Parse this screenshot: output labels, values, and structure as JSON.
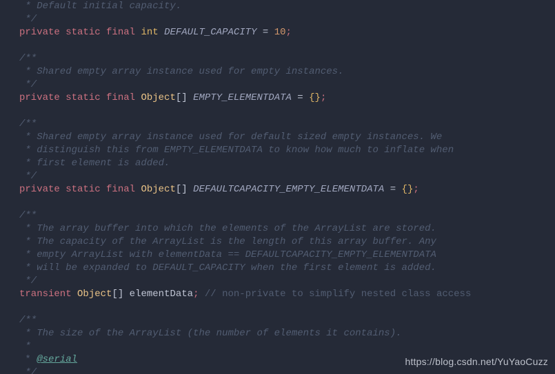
{
  "code": {
    "l1": " * Default initial capacity.",
    "l2": " */",
    "l3_kw": "private static final",
    "l3_type": "int",
    "l3_name": "DEFAULT_CAPACITY",
    "l3_eq": " = ",
    "l3_val": "10",
    "l3_semi": ";",
    "l4": "",
    "l5": "/**",
    "l6": " * Shared empty array instance used for empty instances.",
    "l7": " */",
    "l8_kw": "private static final",
    "l8_type": "Object",
    "l8_arr": "[] ",
    "l8_name": "EMPTY_ELEMENTDATA",
    "l8_eq": " = ",
    "l8_brace": "{}",
    "l8_semi": ";",
    "l9": "",
    "l10": "/**",
    "l11": " * Shared empty array instance used for default sized empty instances. We",
    "l12": " * distinguish this from EMPTY_ELEMENTDATA to know how much to inflate when",
    "l13": " * first element is added.",
    "l14": " */",
    "l15_kw": "private static final",
    "l15_type": "Object",
    "l15_arr": "[] ",
    "l15_name": "DEFAULTCAPACITY_EMPTY_ELEMENTDATA",
    "l15_eq": " = ",
    "l15_brace": "{}",
    "l15_semi": ";",
    "l16": "",
    "l17": "/**",
    "l18": " * The array buffer into which the elements of the ArrayList are stored.",
    "l19": " * The capacity of the ArrayList is the length of this array buffer. Any",
    "l20": " * empty ArrayList with elementData == DEFAULTCAPACITY_EMPTY_ELEMENTDATA",
    "l21": " * will be expanded to DEFAULT_CAPACITY when the first element is added.",
    "l22": " */",
    "l23_kw": "transient",
    "l23_type": "Object",
    "l23_arr": "[] ",
    "l23_name": "elementData",
    "l23_semi": ";",
    "l23_cmt": " // non-private to simplify nested class access",
    "l24": "",
    "l25": "/**",
    "l26": " * The size of the ArrayList (the number of elements it contains).",
    "l27": " *",
    "l28_star": " * ",
    "l28_tag": "@serial",
    "l29": " */"
  },
  "watermark": "https://blog.csdn.net/YuYaoCuzz"
}
